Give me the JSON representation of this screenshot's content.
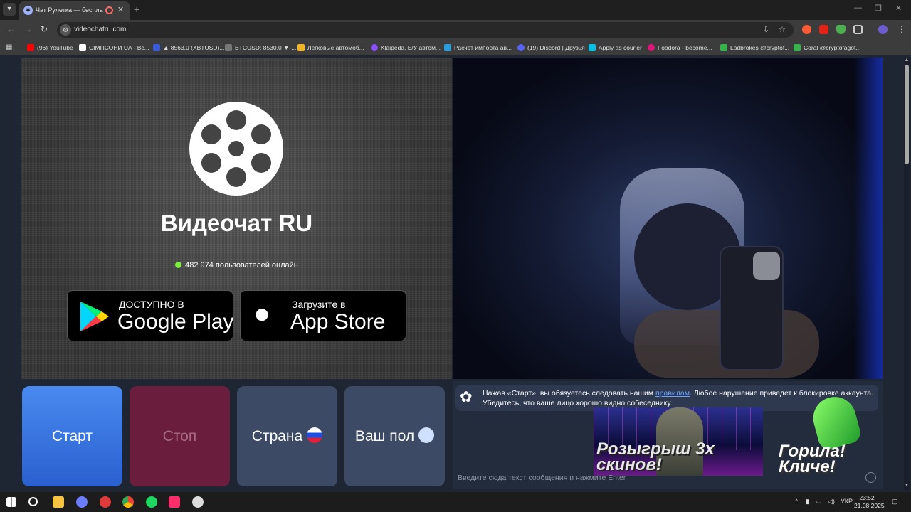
{
  "browser": {
    "tab_title": "Чат Рулетка — бесплатный",
    "address": "videochatru.com",
    "bookmarks": [
      {
        "label": "(96) YouTube",
        "color": "#ff0000"
      },
      {
        "label": "СІМПСОНИ UA - Вс...",
        "color": "#ffffff"
      },
      {
        "label": "▲ 8563.0 (XBTUSD)...",
        "color": "#3a5bd9"
      },
      {
        "label": "BTCUSD: 8530.0 ▼-...",
        "color": "#222222"
      },
      {
        "label": "Легковые автомоб...",
        "color": "#f0b429"
      },
      {
        "label": "Klaipeda, Б/У автом...",
        "color": "#8a4fff"
      },
      {
        "label": "Расчет импорта ав...",
        "color": "#2d9cdb"
      },
      {
        "label": "(19) Discord | Друзья",
        "color": "#5865f2"
      },
      {
        "label": "Apply as courier",
        "color": "#00c2e8"
      },
      {
        "label": "Foodora - become...",
        "color": "#e0157a"
      },
      {
        "label": "Ladbrokes @cryptof...",
        "color": "#37b24d"
      },
      {
        "label": "Coral @cryptofagot...",
        "color": "#37b24d"
      }
    ]
  },
  "left": {
    "site_title": "Видеочат RU",
    "online_text": "482 974 пользователей онлайн",
    "google_play": {
      "small": "ДОСТУПНО В",
      "big": "Google Play"
    },
    "app_store": {
      "small": "Загрузите в",
      "big": "App Store"
    }
  },
  "controls": {
    "start": "Старт",
    "stop": "Стоп",
    "country": "Страна",
    "gender": "Ваш пол"
  },
  "chat": {
    "message_before_link": "Нажав «Старт», вы обязуетесь следовать нашим ",
    "message_link": "правилам",
    "message_after_link": ". Любое нарушение приведет к блокировке аккаунта. Убедитесь, что ваше лицо хорошо видно собеседнику.",
    "input_placeholder": "Введите сюда текст сообщения и нажмите Enter",
    "promo_text": "Розыгрыш 3х скинов!",
    "gorilla_text": "Горила! Кличе!"
  },
  "taskbar": {
    "language": "УКР",
    "time": "23:52",
    "date": "21.08.2025"
  }
}
